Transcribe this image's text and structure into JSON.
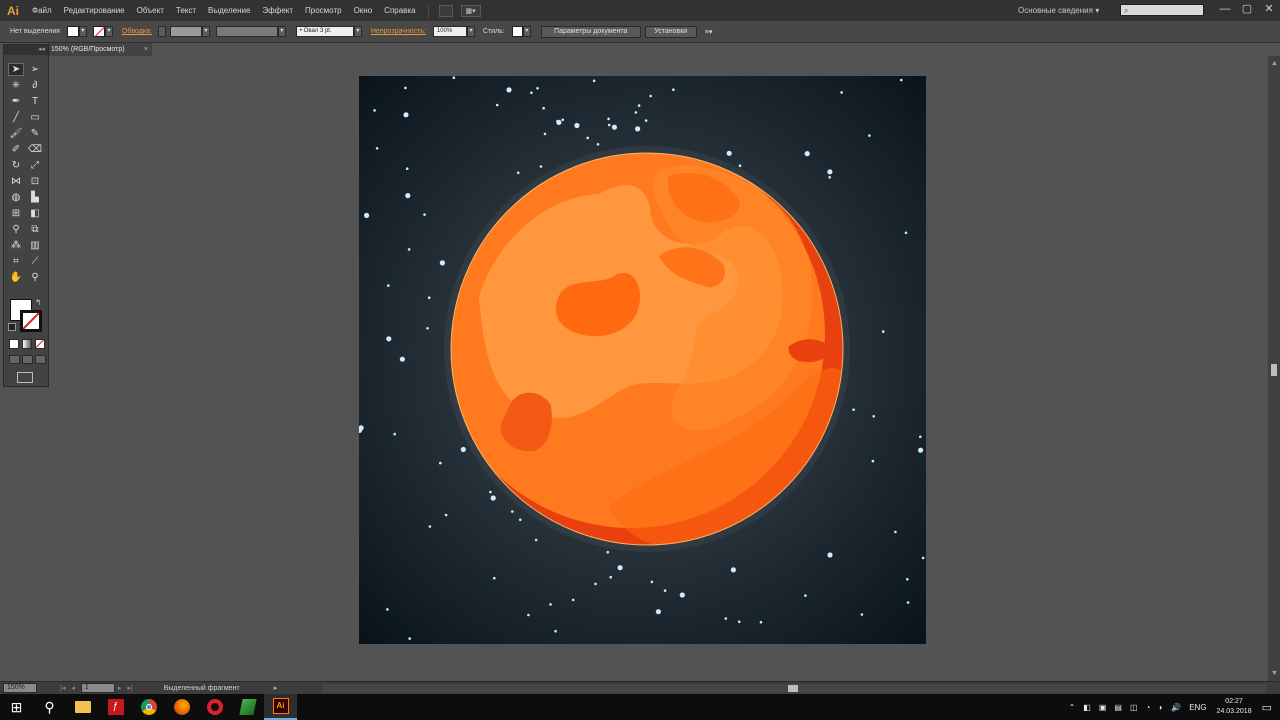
{
  "app": {
    "logo": "Ai",
    "menu": [
      "Файл",
      "Редактирование",
      "Объект",
      "Текст",
      "Выделение",
      "Эффект",
      "Просмотр",
      "Окно",
      "Справка"
    ],
    "workspace": "Основные сведения",
    "workspace_arrow": "▾",
    "search_icon": "⌕",
    "window_controls": [
      "—",
      "▢",
      "✕"
    ]
  },
  "control_bar": {
    "selection_label": "Нет выделения",
    "stroke_link": "Обводка:",
    "brush_value": "Овал 3 pt.",
    "brush_bullet": "•",
    "opacity_link": "Непрозрачность:",
    "opacity_value": "100%",
    "style_label": "Стиль:",
    "doc_settings_button": "Параметры документа",
    "preferences_button": "Установки",
    "menu_glyph": "≡▾",
    "dropdown_arrow": "▾"
  },
  "document": {
    "tab_label": "150% (RGB/Просмотр)",
    "tab_close": "×"
  },
  "status_bar": {
    "zoom": "150%",
    "artboard": "1",
    "status_text": "Выделенный фрагмент",
    "nav_first": "|◂",
    "nav_prev": "◂",
    "nav_next": "▸",
    "nav_last": "▸|",
    "arrow": "▸"
  },
  "taskbar": {
    "language": "ENG",
    "time": "02:27",
    "date": "24.03.2018",
    "start_glyph": "⊞",
    "search_glyph": "⚲",
    "tray_arrow": "⌃",
    "tray_glyphs": [
      "◧",
      "▣",
      "▤",
      "◫",
      "◔",
      "◗",
      "🔊"
    ],
    "notification_glyph": "▭",
    "active_app_label": "Ai"
  },
  "icons": {
    "taskbar": [
      "windows-start-icon",
      "search-icon",
      "file-explorer-icon",
      "flash-icon",
      "chrome-icon",
      "firefox-icon",
      "opera-icon",
      "notepad-icon",
      "illustrator-icon"
    ],
    "tools": [
      "selection-tool-icon",
      "direct-selection-tool-icon",
      "magic-wand-tool-icon",
      "lasso-tool-icon",
      "pen-tool-icon",
      "type-tool-icon",
      "line-tool-icon",
      "rectangle-tool-icon",
      "paintbrush-tool-icon",
      "pencil-tool-icon",
      "blob-brush-tool-icon",
      "eraser-tool-icon",
      "rotate-tool-icon",
      "scale-tool-icon",
      "width-tool-icon",
      "free-transform-tool-icon",
      "shape-builder-tool-icon",
      "perspective-grid-tool-icon",
      "mesh-tool-icon",
      "gradient-tool-icon",
      "eyedropper-tool-icon",
      "blend-tool-icon",
      "symbol-sprayer-tool-icon",
      "column-graph-tool-icon",
      "artboard-tool-icon",
      "slice-tool-icon",
      "hand-tool-icon",
      "zoom-tool-icon"
    ]
  },
  "colors": {
    "planet_main": "#ff7a1e",
    "planet_shadow": "#e8400e",
    "planet_highlight": "#ffa24a",
    "planet_spot": "#ff6a10",
    "space_center": "#5a6670",
    "space_edge": "#07121a",
    "star": "#cdeefa"
  }
}
